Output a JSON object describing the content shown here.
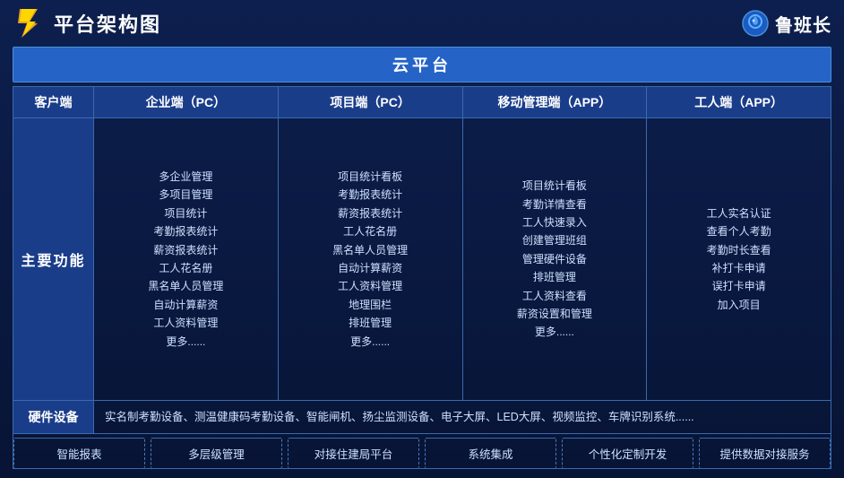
{
  "header": {
    "title": "平台架构图",
    "brand_name": "鲁班长"
  },
  "cloud_banner": "云平台",
  "col_headers": {
    "client": "客户端",
    "enterprise": "企业端（PC）",
    "project": "项目端（PC）",
    "mobile": "移动管理端（APP）",
    "worker": "工人端（APP）"
  },
  "main_function_label": "主要功能",
  "enterprise_features": [
    "多企业管理",
    "多项目管理",
    "项目统计",
    "考勤报表统计",
    "薪资报表统计",
    "工人花名册",
    "黑名单人员管理",
    "自动计算薪资",
    "工人资料管理",
    "更多......"
  ],
  "project_features": [
    "项目统计看板",
    "考勤报表统计",
    "薪资报表统计",
    "工人花名册",
    "黑名单人员管理",
    "自动计算薪资",
    "工人资料管理",
    "地理围栏",
    "排班管理",
    "更多......"
  ],
  "mobile_features": [
    "项目统计看板",
    "考勤详情查看",
    "工人快速录入",
    "创建管理班组",
    "管理硬件设备",
    "排班管理",
    "工人资料查看",
    "薪资设置和管理",
    "更多......"
  ],
  "worker_features": [
    "工人实名认证",
    "查看个人考勤",
    "考勤时长查看",
    "补打卡申请",
    "误打卡申请",
    "加入项目"
  ],
  "hardware_label": "硬件设备",
  "hardware_content": "实名制考勤设备、测温健康码考勤设备、智能闸机、扬尘监测设备、电子大屏、LED大屏、视频监控、车牌识别系统......",
  "bottom_features": [
    "智能报表",
    "多层级管理",
    "对接住建局平台",
    "系统集成",
    "个性化定制开发",
    "提供数据对接服务"
  ]
}
